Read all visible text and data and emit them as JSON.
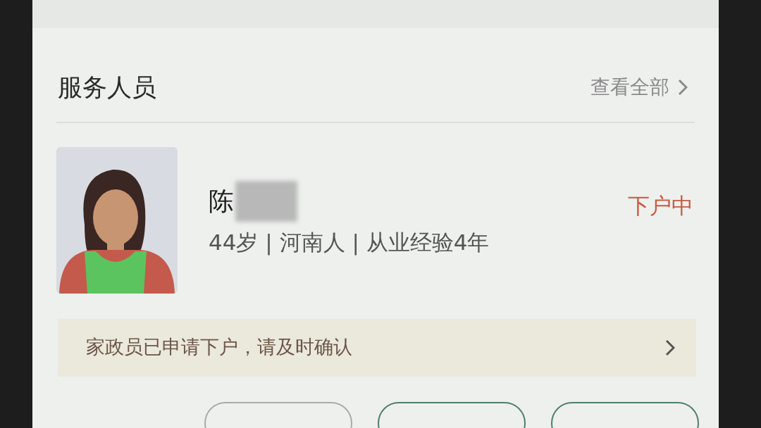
{
  "section": {
    "title": "服务人员",
    "view_all": "查看全部"
  },
  "worker": {
    "name": "陈",
    "name_blurred": true,
    "details": "44岁 | 河南人 | 从业经验4年",
    "status": "下户中"
  },
  "notice": {
    "text": "家政员已申请下户，请及时确认"
  },
  "action_buttons": [
    {
      "kind": "outline"
    },
    {
      "kind": "outline-dark"
    },
    {
      "kind": "outline-dark"
    }
  ]
}
